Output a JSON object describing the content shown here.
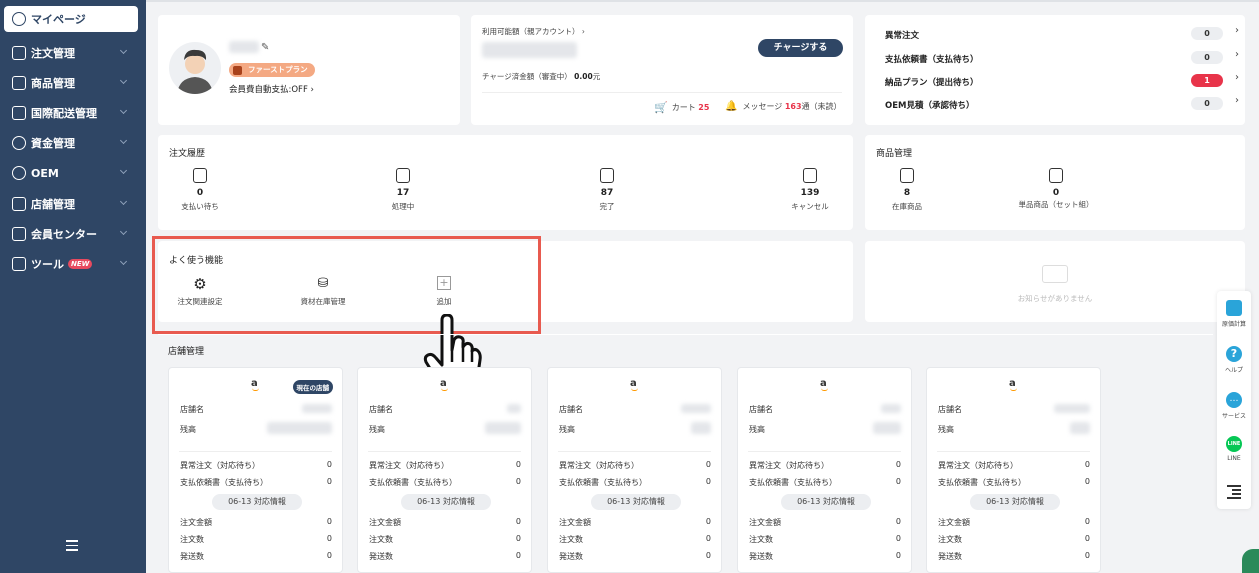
{
  "sidebar": {
    "items": [
      {
        "label": "マイページ"
      },
      {
        "label": "注文管理"
      },
      {
        "label": "商品管理"
      },
      {
        "label": "国際配送管理"
      },
      {
        "label": "資金管理"
      },
      {
        "label": "OEM"
      },
      {
        "label": "店舗管理"
      },
      {
        "label": "会員センター"
      },
      {
        "label": "ツール"
      }
    ],
    "new_badge": "NEW"
  },
  "profile": {
    "plan": "ファーストプラン",
    "auto_pay": "会員費自動支払:OFF",
    "auto_pay_chevron": "›"
  },
  "balance": {
    "label": "利用可能額（親アカウント）",
    "label_chevron": "›",
    "charge_button": "チャージする",
    "charged_label": "チャージ済金額（審査中）",
    "charged_value": "0.00",
    "charged_unit": "元",
    "cart_label": "カート",
    "cart_count": "25",
    "message_label": "メッセージ",
    "message_count": "163",
    "message_suffix": "通（未読）"
  },
  "alerts": [
    {
      "label": "異常注文",
      "count": "0"
    },
    {
      "label": "支払依頼書（支払待ち）",
      "count": "0"
    },
    {
      "label": "納品プラン（提出待ち）",
      "count": "1"
    },
    {
      "label": "OEM見積（承認待ち）",
      "count": "0"
    }
  ],
  "order_history": {
    "title": "注文履歴",
    "stats": [
      {
        "value": "0",
        "label": "支払い待ち"
      },
      {
        "value": "17",
        "label": "処理中"
      },
      {
        "value": "87",
        "label": "完了"
      },
      {
        "value": "139",
        "label": "キャンセル"
      }
    ]
  },
  "product_mgmt": {
    "title": "商品管理",
    "stats": [
      {
        "value": "8",
        "label": "在庫商品"
      },
      {
        "value": "0",
        "label": "単品商品（セット組）"
      }
    ]
  },
  "quick": {
    "title": "よく使う機能",
    "items": [
      {
        "label": "注文関連設定"
      },
      {
        "label": "資材在庫管理"
      },
      {
        "label": "追加"
      }
    ]
  },
  "notice": {
    "empty": "お知らせがありません"
  },
  "stores": {
    "title": "店舗管理",
    "current_badge": "現在の店舗",
    "amazon": "a",
    "name_label": "店舗名",
    "balance_label": "残高",
    "abnormal_label": "異常注文（対応待ち）",
    "payreq_label": "支払依頼書（支払待ち）",
    "date_label": "06-13 対応情報",
    "amount_label": "注文金額",
    "orders_label": "注文数",
    "shipped_label": "発送数",
    "values": [
      "0",
      "0",
      "0",
      "0",
      "0"
    ]
  },
  "right_panel": {
    "items": [
      {
        "label": "原価計算"
      },
      {
        "label": "ヘルプ"
      },
      {
        "label": "サービス"
      },
      {
        "label": "LINE"
      }
    ],
    "line_icon_text": "LINE"
  },
  "colors": {
    "sidebar": "#2f4665",
    "highlight": "#e85a4f",
    "danger": "#e8344a",
    "amazon": "#ff9900",
    "line": "#06c755"
  }
}
